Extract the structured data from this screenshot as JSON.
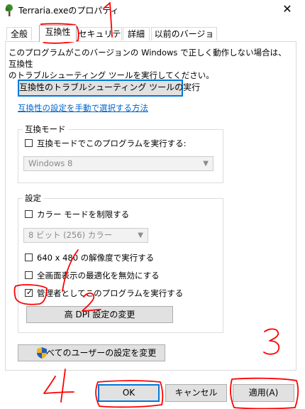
{
  "window": {
    "title": "Terraria.exeのプロパティ",
    "close_glyph": "✕"
  },
  "tabs": [
    {
      "label": "全般"
    },
    {
      "label": "互換性"
    },
    {
      "label": "セキュリティ"
    },
    {
      "label": "詳細"
    },
    {
      "label": "以前のバージョン"
    }
  ],
  "intro": {
    "text_line1": "このプログラムがこのバージョンの Windows で正しく動作しない場合は、互換性",
    "text_line2": "のトラブルシューティング ツールを実行してください。"
  },
  "troubleshoot_button": "互換性のトラブルシューティング ツールの実行",
  "manual_link": "互換性の設定を手動で選択する方法",
  "compat_mode": {
    "legend": "互換モード",
    "checkbox_label": "互換モードでこのプログラムを実行する:",
    "checked": false,
    "select_value": "Windows 8"
  },
  "settings": {
    "legend": "設定",
    "reduced_color": {
      "label": "カラー モードを制限する",
      "checked": false
    },
    "color_select_value": "8 ビット (256) カラー",
    "res_640": {
      "label": "640 x 480 の解像度で実行する",
      "checked": false
    },
    "fullscreen_opt": {
      "label": "全画面表示の最適化を無効にする",
      "checked": false
    },
    "run_as_admin": {
      "label": "管理者としてこのプログラムを実行する",
      "checked": true
    },
    "high_dpi_button": "高 DPI 設定の変更"
  },
  "all_users_button": "すべてのユーザーの設定を変更",
  "footer": {
    "ok": "OK",
    "cancel": "キャンセル",
    "apply": "適用(A)"
  },
  "annotations": {
    "n1": "1",
    "n2": "2",
    "n3": "3",
    "n4": "4",
    "color": "#ff0000"
  },
  "colors": {
    "focus": "#0078d7",
    "link": "#0066cc",
    "button_bg": "#e1e1e1"
  }
}
